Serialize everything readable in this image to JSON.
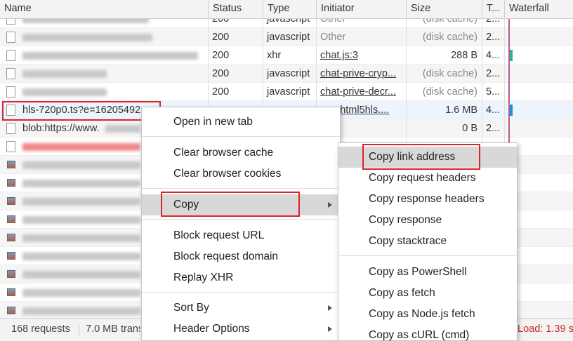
{
  "columns": [
    "Name",
    "Status",
    "Type",
    "Initiator",
    "Size",
    "T...",
    "Waterfall"
  ],
  "rows": [
    {
      "name": "",
      "status": "200",
      "type": "javascript",
      "initiator": "Other",
      "size": "(disk cache)",
      "time": "2..."
    },
    {
      "name": "",
      "status": "200",
      "type": "javascript",
      "initiator": "Other",
      "size": "(disk cache)",
      "time": "2..."
    },
    {
      "name": "",
      "status": "200",
      "type": "xhr",
      "initiator": "chat.js:3",
      "size": "288 B",
      "time": "4..."
    },
    {
      "name": "",
      "status": "200",
      "type": "javascript",
      "initiator": "chat-prive-cryp...",
      "size": "(disk cache)",
      "time": "2..."
    },
    {
      "name": "",
      "status": "200",
      "type": "javascript",
      "initiator": "chat-prive-decr...",
      "size": "(disk cache)",
      "time": "5..."
    },
    {
      "name": "hls-720p0.ts?e=16205492",
      "status": "",
      "type": "",
      "initiator": "...er.html5hls....",
      "size": "1.6 MB",
      "time": "4..."
    },
    {
      "name": "blob:https://www.",
      "status": "",
      "type": "",
      "initiator": "...er",
      "size": "0 B",
      "time": "2..."
    }
  ],
  "footer": {
    "requests": "168 requests",
    "transferred": "7.0 MB trans",
    "load": "Load: 1.39 s"
  },
  "context_menu": {
    "items": [
      "Open in new tab",
      "Clear browser cache",
      "Clear browser cookies",
      "Copy",
      "Block request URL",
      "Block request domain",
      "Replay XHR",
      "Sort By",
      "Header Options"
    ]
  },
  "copy_submenu": {
    "items": [
      "Copy link address",
      "Copy request headers",
      "Copy response headers",
      "Copy response",
      "Copy stacktrace",
      "Copy as PowerShell",
      "Copy as fetch",
      "Copy as Node.js fetch",
      "Copy as cURL (cmd)"
    ]
  },
  "colors": {
    "highlight_outline": "#d9262c",
    "waterfall_line": "#b85a8f",
    "waterfall_bar_green": "#2bb58a",
    "waterfall_bar_blue": "#1a8fe0"
  }
}
